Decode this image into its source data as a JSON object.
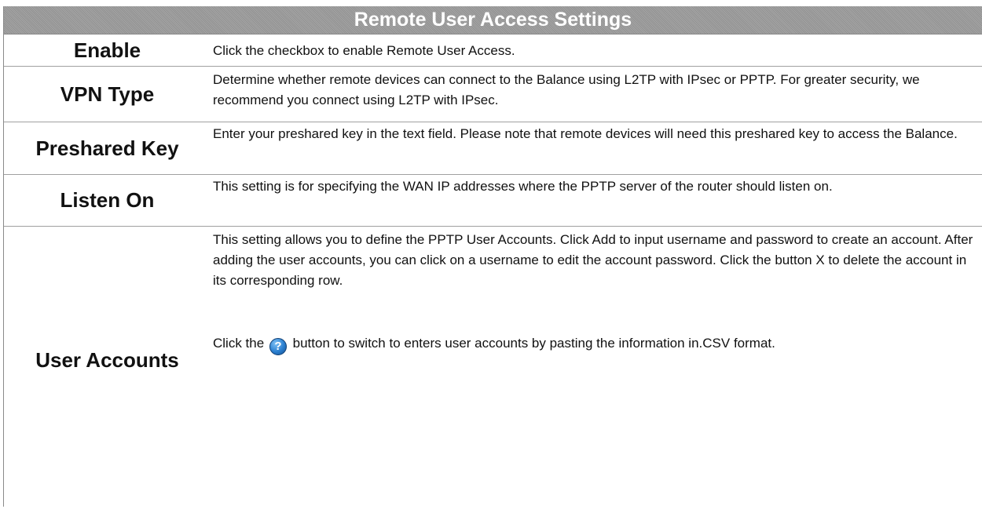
{
  "header": {
    "title": "Remote User Access Settings"
  },
  "rows": [
    {
      "label": "Enable",
      "description": "Click the checkbox to enable Remote User Access."
    },
    {
      "label": "VPN Type",
      "description": "Determine whether remote devices can connect to the Balance using L2TP with IPsec or PPTP. For greater security, we recommend you connect using L2TP with IPsec."
    },
    {
      "label": "Preshared Key",
      "description": "Enter your preshared key in the text field. Please note that remote devices will need this preshared key to access the Balance."
    },
    {
      "label": "Listen On",
      "description": "This setting is for specifying the WAN IP addresses where the PPTP server of the router should listen on."
    },
    {
      "label": "User Accounts",
      "description": "This setting allows you to define the PPTP User Accounts. Click Add to input username and password to create an account. After adding the user accounts, you can click on a username to edit the account password. Click the button X to delete the account in its corresponding row.",
      "description_2_before_icon": "Click the",
      "icon": "help-question-icon",
      "icon_glyph": "?",
      "description_2_after_icon": " button to switch to enters user accounts by pasting the information in.CSV format."
    }
  ]
}
